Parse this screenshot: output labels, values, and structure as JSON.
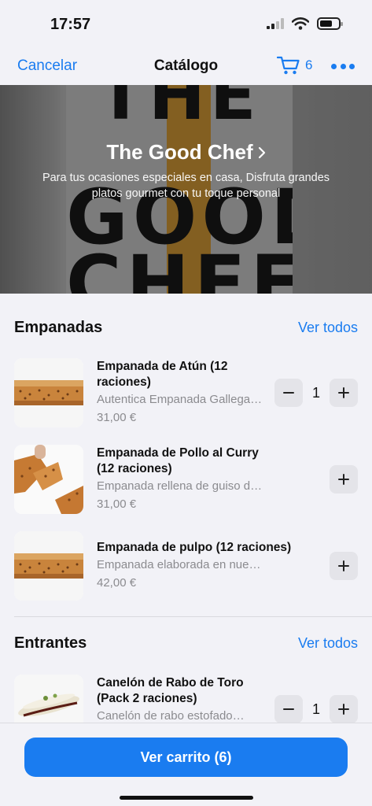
{
  "status": {
    "time": "17:57"
  },
  "nav": {
    "cancel": "Cancelar",
    "title": "Catálogo",
    "cart_count": "6"
  },
  "hero": {
    "title": "The Good Chef",
    "subtitle": "Para tus ocasiones especiales en casa,  Disfruta grandes platos gourmet con tu toque personal",
    "logo_text": [
      "THE",
      "GOOD",
      "CHEF"
    ]
  },
  "sections": [
    {
      "title": "Empanadas",
      "link": "Ver todos",
      "products": [
        {
          "name": "Empanada de Atún (12 raciones)",
          "description": "Autentica Empanada Gallega…",
          "price": "31,00 €",
          "quantity": "1"
        },
        {
          "name": "Empanada de Pollo al Curry (12 raciones)",
          "description": "Empanada rellena de guiso de pollo…",
          "price": "31,00 €"
        },
        {
          "name": "Empanada de pulpo (12 raciones)",
          "description": "Empanada elaborada en nuestro obrador…",
          "price": "42,00 €"
        }
      ]
    },
    {
      "title": "Entrantes",
      "link": "Ver todos",
      "products": [
        {
          "name": "Canelón de Rabo de Toro (Pack 2 raciones)",
          "description": "Canelón de rabo estofado…",
          "quantity": "1"
        }
      ]
    }
  ],
  "footer": {
    "button": "Ver carrito (6)"
  },
  "colors": {
    "accent": "#1a7cf0",
    "background": "#f2f2f7",
    "muted": "#8b8b8f"
  }
}
